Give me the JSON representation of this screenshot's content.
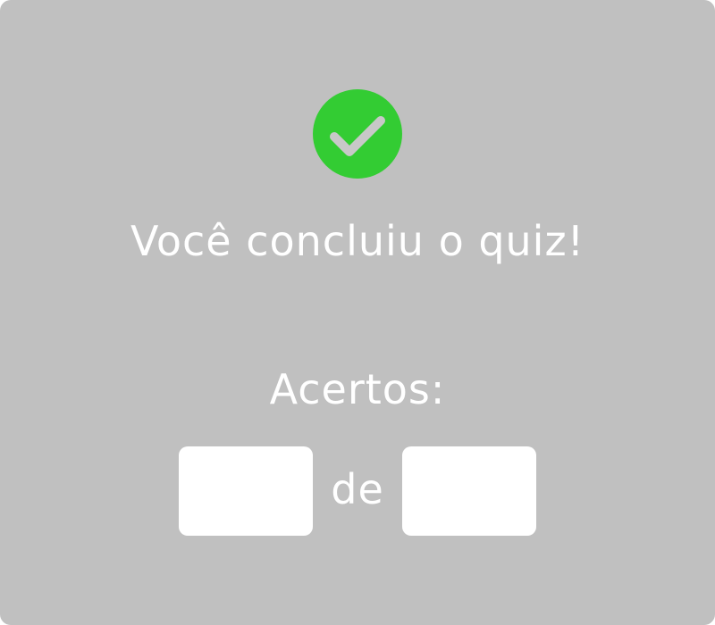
{
  "result": {
    "icon": "check-circle-icon",
    "icon_color": "#33cc33",
    "title": "Você concluiu o quiz!"
  },
  "score": {
    "label": "Acertos:",
    "correct_value": "",
    "separator": "de",
    "total_value": ""
  },
  "colors": {
    "background": "#c0c0c0",
    "text": "#ffffff",
    "box": "#ffffff"
  }
}
